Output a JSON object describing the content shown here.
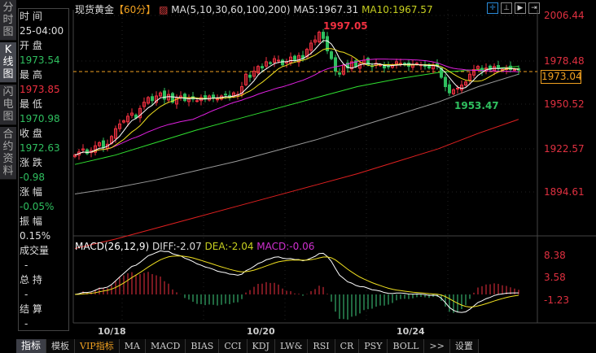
{
  "side_tabs": [
    "分时图",
    "K线图",
    "闪电图",
    "合约资料"
  ],
  "active_side_tab": 1,
  "info": [
    {
      "label": "时 间",
      "value": "25-04:00",
      "color": "w"
    },
    {
      "label": "开 盘",
      "value": "1973.54",
      "color": "g"
    },
    {
      "label": "最 高",
      "value": "1973.85",
      "color": "r"
    },
    {
      "label": "最 低",
      "value": "1970.98",
      "color": "g"
    },
    {
      "label": "收 盘",
      "value": "1972.63",
      "color": "g"
    },
    {
      "label": "涨 跌",
      "value": "-0.98",
      "color": "g"
    },
    {
      "label": "涨 幅",
      "value": "-0.05%",
      "color": "g"
    },
    {
      "label": "振 幅",
      "value": "0.15%",
      "color": "w"
    },
    {
      "label": "成交量",
      "value": "-",
      "color": "w"
    },
    {
      "label": "总 持",
      "value": "-",
      "color": "w"
    },
    {
      "label": "结 算",
      "value": "-",
      "color": "w"
    }
  ],
  "header": {
    "symbol": "现货黄金",
    "period": "【60分】",
    "ma_label": "MA(5,10,30,60,100,200)",
    "ma5": "MA5:1967.31",
    "ma10": "MA10:1967.57"
  },
  "macd_header": {
    "name": "MACD(26,12,9)",
    "diff": "DIFF:-2.07",
    "dea": "DEA:-2.04",
    "macd": "MACD:-0.06"
  },
  "last_price": "1973.04",
  "annotations": {
    "high": "1997.05",
    "low": "1953.47"
  },
  "bottom_tabs": [
    "指标",
    "模板",
    "VIP指标",
    "MA",
    "MACD",
    "BIAS",
    "CCI",
    "KDJ",
    "LW&",
    "RSI",
    "CR",
    "PSY",
    "BOLL",
    ">>",
    "设置"
  ],
  "colors": {
    "up": "#f03040",
    "down": "#2fbf5f",
    "ma5": "#ffffff",
    "ma10": "#f0e020",
    "ma30": "#e020e0",
    "ma60": "#30e030",
    "ma100": "#999999",
    "ma200": "#e02020"
  },
  "chart_data": {
    "type": "candlestick",
    "price_axis": [
      "2006.44",
      "1978.48",
      "1950.52",
      "1922.57",
      "1894.61"
    ],
    "macd_axis": [
      "8.38",
      "3.58",
      "-1.23"
    ],
    "x_labels": [
      "10/18",
      "10/20",
      "10/24"
    ],
    "closes": [
      1918,
      1920,
      1922,
      1919,
      1921,
      1924,
      1926,
      1923,
      1925,
      1930,
      1935,
      1938,
      1940,
      1943,
      1945,
      1942,
      1948,
      1952,
      1955,
      1953,
      1956,
      1958,
      1954,
      1957,
      1952,
      1955,
      1956,
      1953,
      1955,
      1954,
      1953,
      1955,
      1954,
      1956,
      1955,
      1954,
      1956,
      1957,
      1955,
      1958,
      1957,
      1962,
      1970,
      1968,
      1972,
      1975,
      1974,
      1978,
      1977,
      1980,
      1979,
      1976,
      1978,
      1981,
      1979,
      1982,
      1980,
      1986,
      1990,
      1992,
      1997,
      1993,
      1985,
      1980,
      1972,
      1970,
      1976,
      1974,
      1978,
      1975,
      1977,
      1979,
      1976,
      1975,
      1977,
      1976,
      1974,
      1975,
      1976,
      1978,
      1977,
      1976,
      1975,
      1976,
      1977,
      1976,
      1975,
      1974,
      1976,
      1975,
      1968,
      1962,
      1958,
      1960,
      1961,
      1963,
      1965,
      1970,
      1973,
      1975,
      1972,
      1974,
      1973,
      1975,
      1974,
      1973,
      1974,
      1973,
      1973,
      1972.6
    ],
    "ma60": [
      1912,
      1918,
      1926,
      1934,
      1941,
      1948,
      1955,
      1962,
      1967,
      1971,
      1973,
      1975
    ],
    "ma100": [
      1893,
      1897,
      1902,
      1908,
      1914,
      1921,
      1928,
      1936,
      1944,
      1952,
      1962,
      1970
    ],
    "ma200": [
      1858,
      1864,
      1871,
      1878,
      1885,
      1892,
      1899,
      1906,
      1914,
      1922,
      1932,
      1941
    ]
  }
}
